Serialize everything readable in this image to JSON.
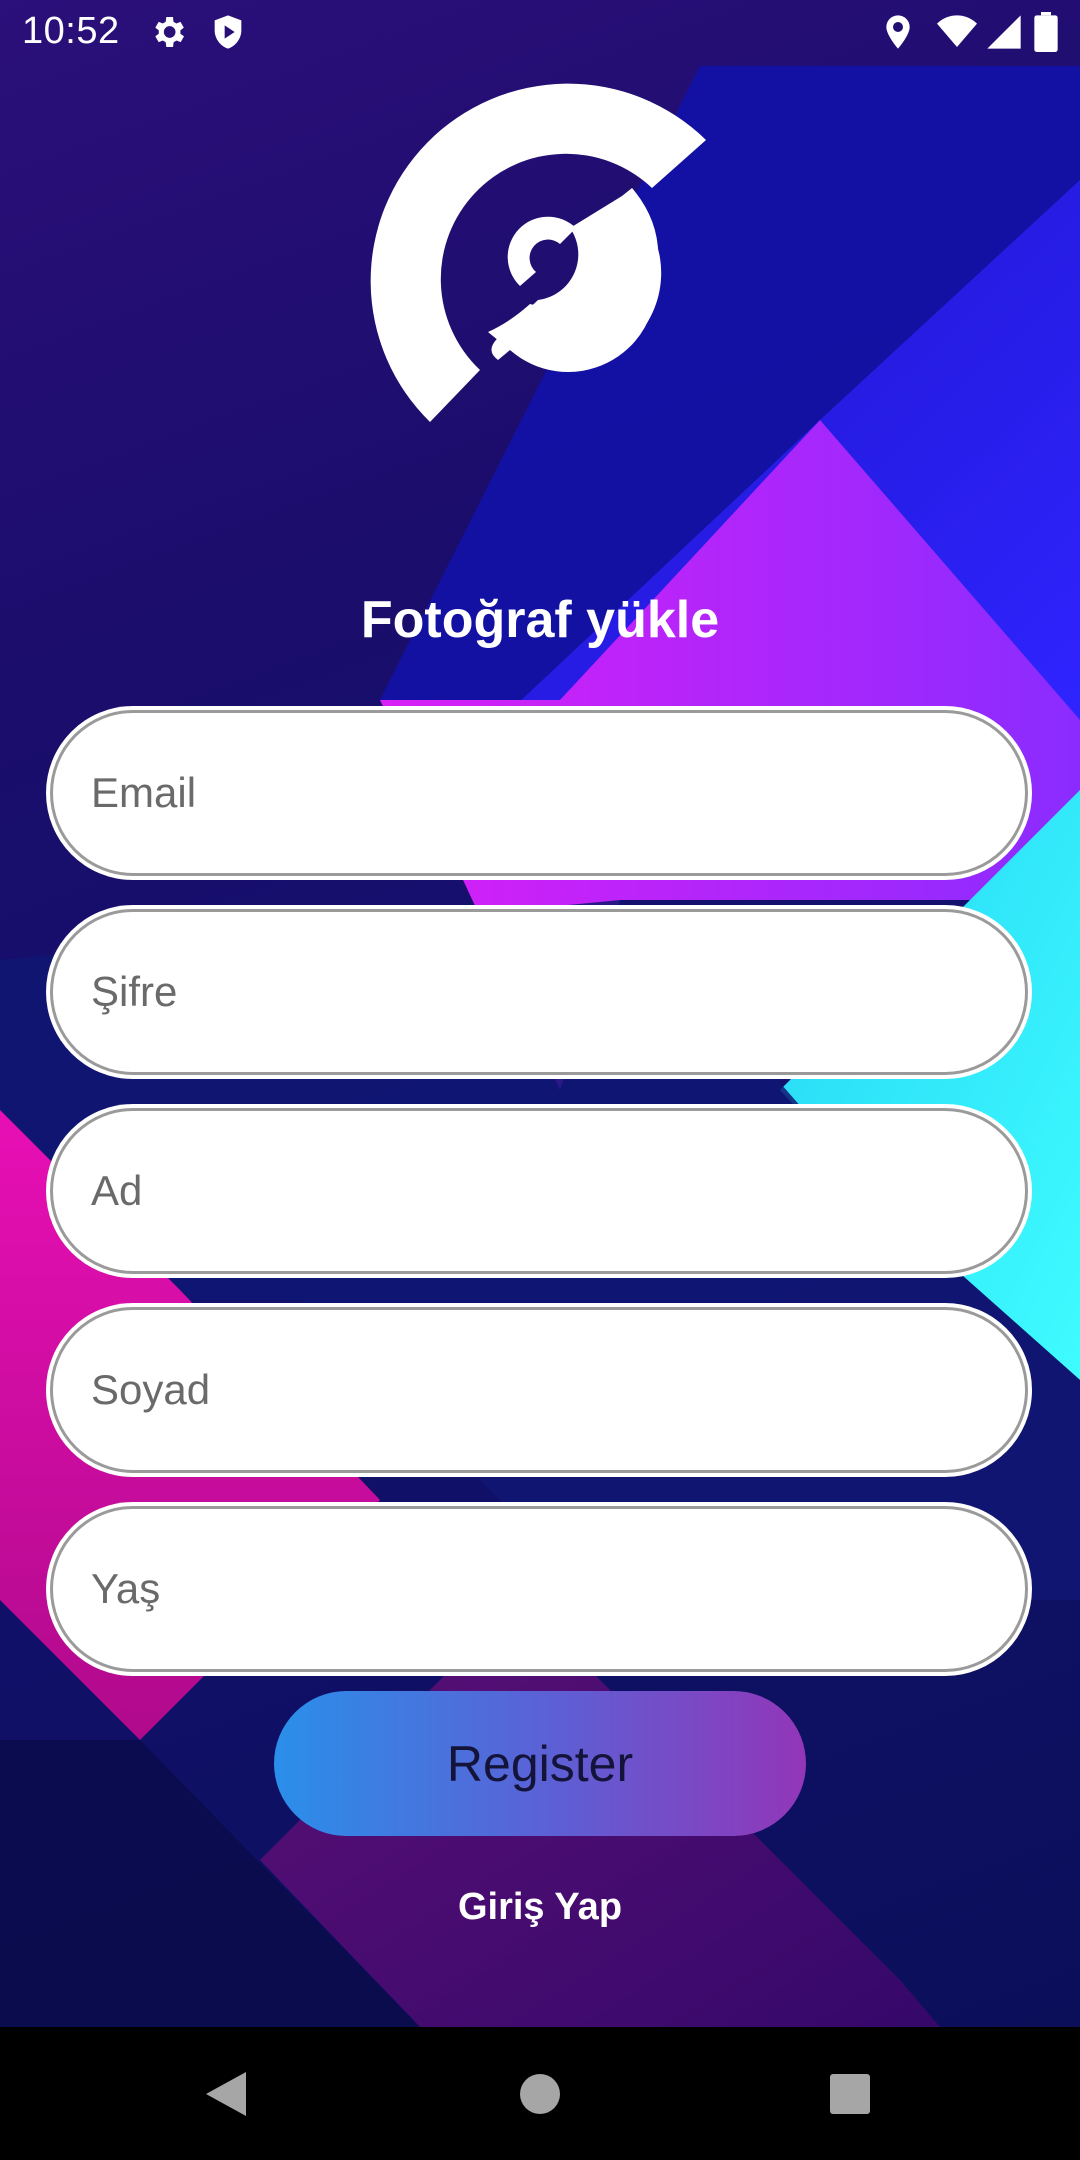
{
  "status_bar": {
    "time": "10:52",
    "icons": [
      "gear-icon",
      "shield-play-icon",
      "location-icon",
      "wifi-icon",
      "signal-icon",
      "battery-icon"
    ]
  },
  "app": {
    "title": "Fotoğraf yükle",
    "fields": [
      {
        "name": "email",
        "placeholder": "Email"
      },
      {
        "name": "password",
        "placeholder": "Şifre"
      },
      {
        "name": "first-name",
        "placeholder": "Ad"
      },
      {
        "name": "last-name",
        "placeholder": "Soyad"
      },
      {
        "name": "age",
        "placeholder": "Yaş"
      }
    ],
    "register_label": "Register",
    "login_label": "Giriş Yap"
  },
  "nav_bar": {
    "buttons": [
      "back-icon",
      "home-icon",
      "recents-icon"
    ]
  },
  "colors": {
    "background_dark": "#12116e",
    "accent_magenta": "#c81ff0",
    "accent_cyan": "#2ef2f8",
    "accent_blue": "#2f24ff",
    "button_start": "#2a8fea",
    "button_end": "#9236b8"
  }
}
